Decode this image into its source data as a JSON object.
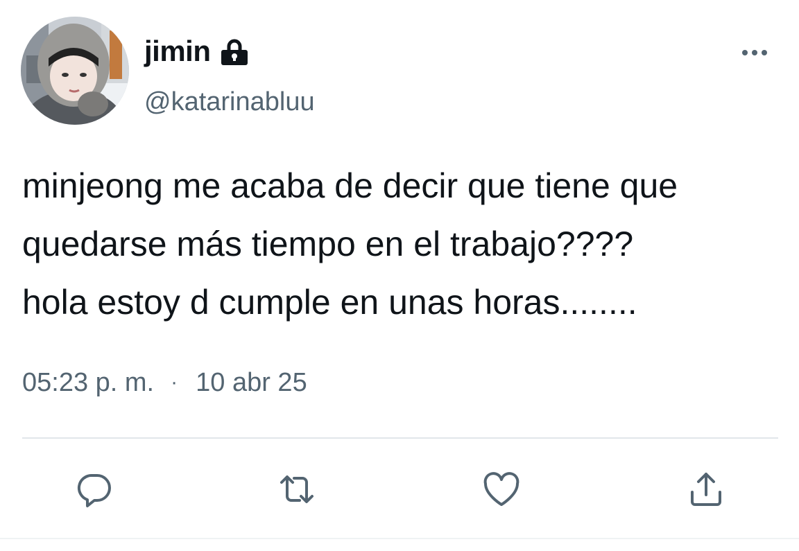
{
  "user": {
    "display_name": "jimin",
    "handle": "@katarinabluu",
    "avatar_icon": "profile-photo",
    "protected_icon": "lock-icon"
  },
  "tweet": {
    "text": "minjeong me acaba de decir que tiene que\nquedarse más tiempo en el trabajo????\nhola estoy d cumple en unas horas........",
    "time": "05:23 p. m.",
    "separator": "·",
    "date": "10 abr 25"
  },
  "actions": [
    {
      "name": "reply",
      "icon": "reply-icon"
    },
    {
      "name": "retweet",
      "icon": "retweet-icon"
    },
    {
      "name": "like",
      "icon": "heart-icon"
    },
    {
      "name": "share",
      "icon": "share-icon"
    }
  ],
  "menu": {
    "icon": "more-options-icon"
  },
  "colors": {
    "text": "#0f1419",
    "secondary": "#536471",
    "divider": "#e1e6ea"
  }
}
